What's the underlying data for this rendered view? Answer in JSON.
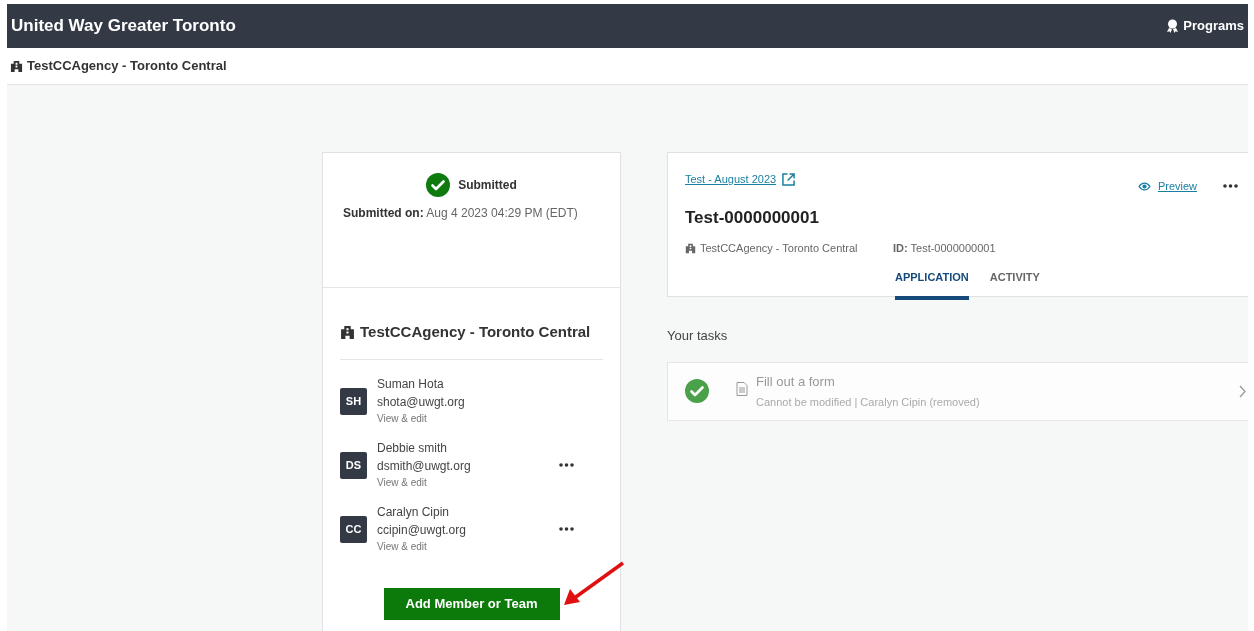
{
  "header": {
    "title": "United Way Greater Toronto",
    "programs": "Programs"
  },
  "breadcrumb": "TestCCAgency - Toronto Central",
  "status": {
    "label": "Submitted",
    "submitted_label": "Submitted on:",
    "submitted_value": "Aug 4 2023 04:29 PM (EDT)"
  },
  "agency": {
    "name": "TestCCAgency - Toronto Central",
    "members": [
      {
        "initials": "SH",
        "name": "Suman Hota",
        "email": "shota@uwgt.org",
        "link": "View & edit",
        "menu": false
      },
      {
        "initials": "DS",
        "name": "Debbie smith",
        "email": "dsmith@uwgt.org",
        "link": "View & edit",
        "menu": true
      },
      {
        "initials": "CC",
        "name": "Caralyn Cipin",
        "email": "ccipin@uwgt.org",
        "link": "View & edit",
        "menu": true
      }
    ],
    "add_button": "Add Member or Team"
  },
  "application": {
    "program_link": "Test - August 2023",
    "preview": "Preview",
    "title": "Test-0000000001",
    "agency": "TestCCAgency - Toronto Central",
    "id_label": "ID:",
    "id_value": "Test-0000000001",
    "tabs": [
      {
        "label": "APPLICATION",
        "selected": true
      },
      {
        "label": "ACTIVITY",
        "selected": false
      }
    ]
  },
  "tasks": {
    "heading": "Your tasks",
    "items": [
      {
        "title": "Fill out a form",
        "subtitle": "Cannot be modified | Caralyn Cipin (removed)",
        "done": true
      }
    ]
  }
}
